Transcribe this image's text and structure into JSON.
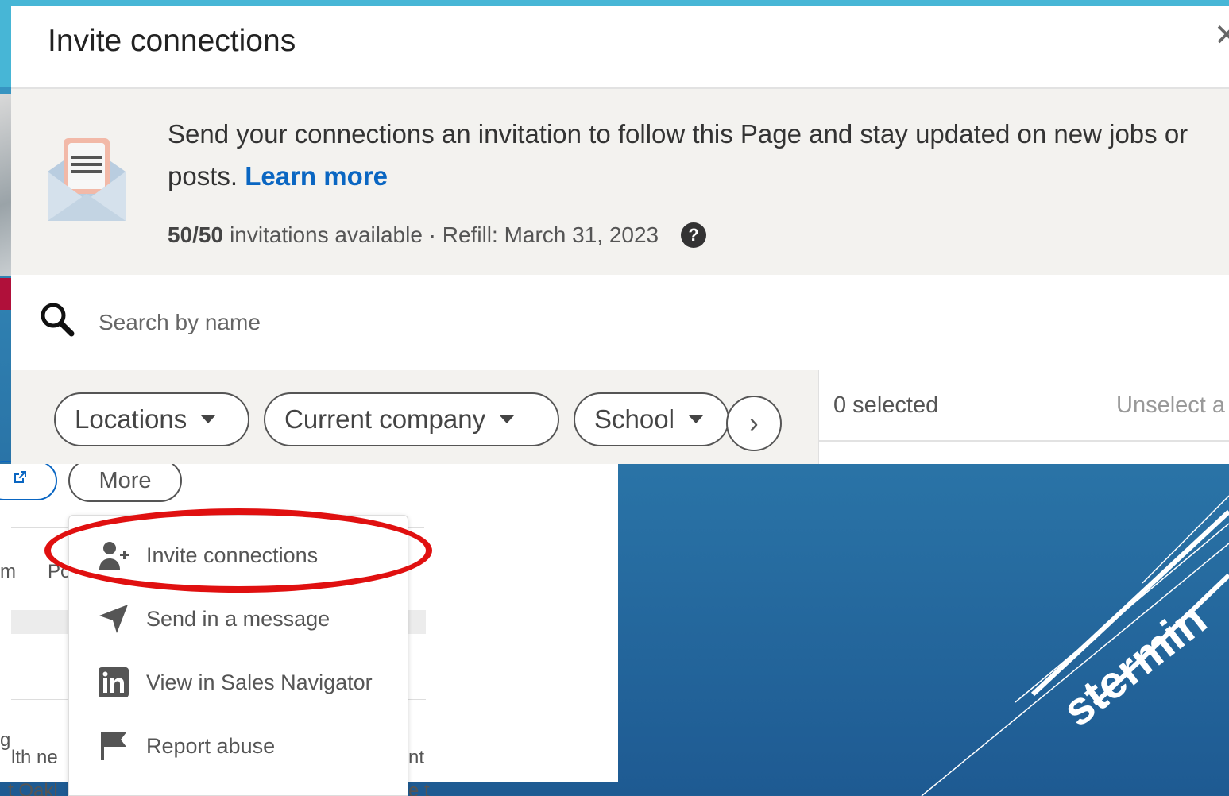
{
  "modal": {
    "title": "Invite connections",
    "info": {
      "text": "Send your connections an invitation to follow this Page and stay updated on new jobs or posts.",
      "learn_more": "Learn more",
      "invitations_count": "50/50",
      "invitations_label": "invitations available · Refill: March 31, 2023"
    },
    "search": {
      "placeholder": "Search by name"
    },
    "filters": [
      {
        "label": "Locations"
      },
      {
        "label": "Current company"
      },
      {
        "label": "School"
      }
    ],
    "selection": {
      "selected": "0 selected",
      "unselect": "Unselect a"
    }
  },
  "background": {
    "more_button": "More",
    "fragments": [
      "m",
      "Po",
      "g",
      "lth ne",
      "nt",
      "t Oakl",
      "e t"
    ],
    "deco_text": "stermin"
  },
  "menu": {
    "items": [
      {
        "label": "Invite connections",
        "icon": "person-add-icon"
      },
      {
        "label": "Send in a message",
        "icon": "send-icon"
      },
      {
        "label": "View in Sales Navigator",
        "icon": "linkedin-icon"
      },
      {
        "label": "Report abuse",
        "icon": "flag-icon"
      }
    ]
  },
  "colors": {
    "accent": "#0a66c2",
    "highlight": "#e01010",
    "backdrop": "#2f7fb0"
  }
}
